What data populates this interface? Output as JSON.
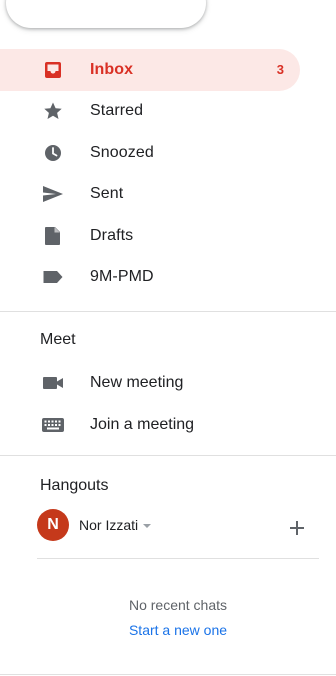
{
  "colors": {
    "accent_red": "#d93025",
    "active_bg": "#fce8e6",
    "link_blue": "#1a73e8",
    "avatar_bg": "#c5391b",
    "icon_gray": "#5f6368"
  },
  "nav": {
    "items": [
      {
        "label": "Inbox",
        "icon": "inbox-icon",
        "count": "3",
        "active": true
      },
      {
        "label": "Starred",
        "icon": "star-icon"
      },
      {
        "label": "Snoozed",
        "icon": "clock-icon"
      },
      {
        "label": "Sent",
        "icon": "send-icon"
      },
      {
        "label": "Drafts",
        "icon": "draft-icon"
      },
      {
        "label": "9M-PMD",
        "icon": "label-icon"
      }
    ]
  },
  "meet": {
    "title": "Meet",
    "items": [
      {
        "label": "New meeting",
        "icon": "videocam-icon"
      },
      {
        "label": "Join a meeting",
        "icon": "keyboard-icon"
      }
    ]
  },
  "hangouts": {
    "title": "Hangouts",
    "user": {
      "initial": "N",
      "name": "Nor Izzati"
    },
    "empty_text": "No recent chats",
    "start_link": "Start a new one"
  }
}
